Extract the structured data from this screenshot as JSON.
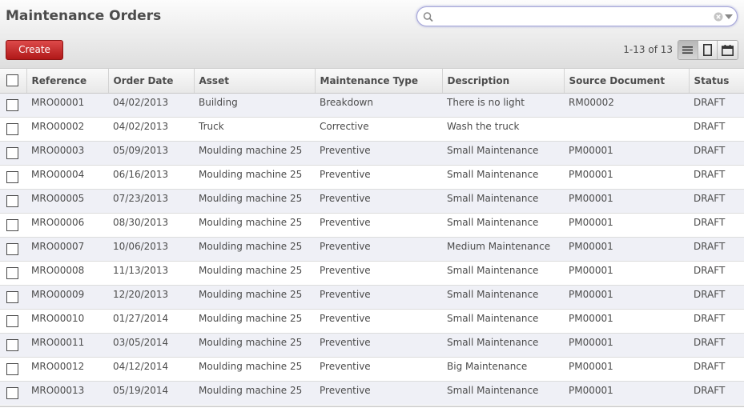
{
  "header": {
    "title": "Maintenance Orders",
    "create_label": "Create",
    "pager": "1-13 of 13"
  },
  "search": {
    "value": "",
    "placeholder": ""
  },
  "views": [
    "list-view-icon",
    "form-view-icon",
    "calendar-view-icon"
  ],
  "colors": {
    "accent": "#c42020",
    "row_alt": "#eff0f6"
  },
  "table": {
    "columns": [
      "Reference",
      "Order Date",
      "Asset",
      "Maintenance Type",
      "Description",
      "Source Document",
      "Status"
    ],
    "rows": [
      [
        "MRO00001",
        "04/02/2013",
        "Building",
        "Breakdown",
        "There is no light",
        "RM00002",
        "DRAFT"
      ],
      [
        "MRO00002",
        "04/02/2013",
        "Truck",
        "Corrective",
        "Wash the truck",
        "",
        "DRAFT"
      ],
      [
        "MRO00003",
        "05/09/2013",
        "Moulding machine 25",
        "Preventive",
        "Small Maintenance",
        "PM00001",
        "DRAFT"
      ],
      [
        "MRO00004",
        "06/16/2013",
        "Moulding machine 25",
        "Preventive",
        "Small Maintenance",
        "PM00001",
        "DRAFT"
      ],
      [
        "MRO00005",
        "07/23/2013",
        "Moulding machine 25",
        "Preventive",
        "Small Maintenance",
        "PM00001",
        "DRAFT"
      ],
      [
        "MRO00006",
        "08/30/2013",
        "Moulding machine 25",
        "Preventive",
        "Small Maintenance",
        "PM00001",
        "DRAFT"
      ],
      [
        "MRO00007",
        "10/06/2013",
        "Moulding machine 25",
        "Preventive",
        "Medium Maintenance",
        "PM00001",
        "DRAFT"
      ],
      [
        "MRO00008",
        "11/13/2013",
        "Moulding machine 25",
        "Preventive",
        "Small Maintenance",
        "PM00001",
        "DRAFT"
      ],
      [
        "MRO00009",
        "12/20/2013",
        "Moulding machine 25",
        "Preventive",
        "Small Maintenance",
        "PM00001",
        "DRAFT"
      ],
      [
        "MRO00010",
        "01/27/2014",
        "Moulding machine 25",
        "Preventive",
        "Small Maintenance",
        "PM00001",
        "DRAFT"
      ],
      [
        "MRO00011",
        "03/05/2014",
        "Moulding machine 25",
        "Preventive",
        "Small Maintenance",
        "PM00001",
        "DRAFT"
      ],
      [
        "MRO00012",
        "04/12/2014",
        "Moulding machine 25",
        "Preventive",
        "Big Maintenance",
        "PM00001",
        "DRAFT"
      ],
      [
        "MRO00013",
        "05/19/2014",
        "Moulding machine 25",
        "Preventive",
        "Small Maintenance",
        "PM00001",
        "DRAFT"
      ]
    ]
  }
}
